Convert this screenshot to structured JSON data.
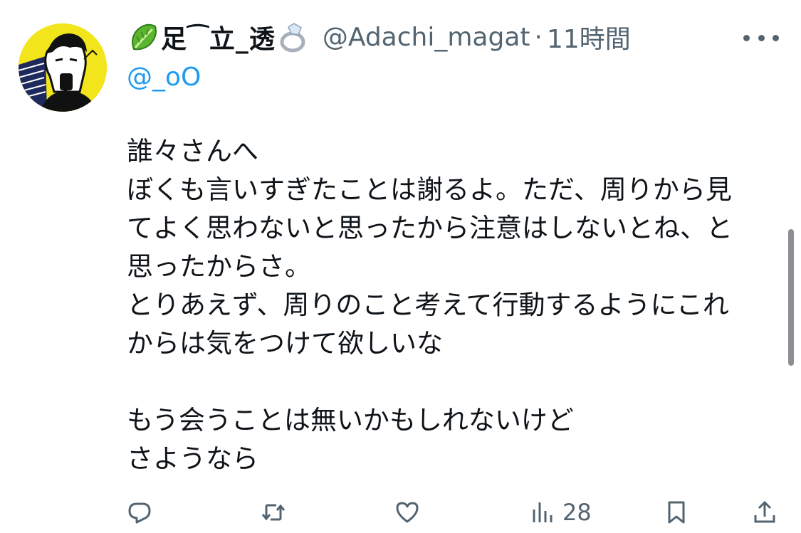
{
  "header": {
    "name_emoji_left": "lettuce-icon",
    "display_name": "足⁀立_透",
    "name_emoji_right": "ring-icon",
    "handle": "@Adachi_magat",
    "separator": "·",
    "time": "11時間"
  },
  "reply_to": "@_oO",
  "body_lines": [
    "誰々さんへ",
    "ぼくも言いすぎたことは謝るよ。ただ、周りから見",
    "てよく思わないと思ったから注意はしないとね、と",
    "思ったからさ。",
    "とりあえず、周りのこと考えて行動するようにこれ",
    "からは気をつけて欲しいな",
    "",
    "もう会うことは無いかもしれないけど",
    "さようなら"
  ],
  "actions": {
    "reply_icon": "reply-icon",
    "retweet_icon": "retweet-icon",
    "like_icon": "heart-icon",
    "views_icon": "views-icon",
    "views_count": "28",
    "bookmark_icon": "bookmark-icon",
    "share_icon": "share-icon"
  },
  "colors": {
    "text": "#0f1419",
    "secondary": "#536471",
    "link": "#1d9bf0",
    "avatar_bg": "#f2e51c"
  }
}
